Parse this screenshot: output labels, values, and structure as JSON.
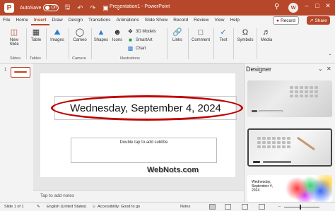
{
  "titlebar": {
    "autosave_label": "AutoSave",
    "autosave_state": "Off",
    "title": "Presentation1 - PowerPoint",
    "avatar_initials": "W"
  },
  "tabs": [
    "File",
    "Home",
    "Insert",
    "Draw",
    "Design",
    "Transitions",
    "Animations",
    "Slide Show",
    "Record",
    "Review",
    "View",
    "Help"
  ],
  "active_tab": "Insert",
  "tabbar": {
    "record_label": "Record",
    "share_label": "Share"
  },
  "ribbon": {
    "new_slide": "New\nSlide",
    "table": "Table",
    "images": "Images",
    "cameo": "Cameo",
    "shapes": "Shapes",
    "icons": "Icons",
    "models3d": "3D Models",
    "smartart": "SmartArt",
    "chart": "Chart",
    "links": "Links",
    "comment": "Comment",
    "text": "Text",
    "symbols": "Symbols",
    "media": "Media",
    "groups": {
      "slides": "Slides",
      "tables": "Tables",
      "camera": "Camera",
      "illustrations": "Illustrations"
    }
  },
  "thumbnails": {
    "slide_number": "1"
  },
  "slide": {
    "title": "Wednesday, September 4, 2024",
    "subtitle_placeholder": "Double tap to add subtitle",
    "watermark": "WebNots.com"
  },
  "notes": {
    "placeholder": "Tap to add notes"
  },
  "designer": {
    "title": "Designer",
    "design3_text": "Wednesday,\nSeptember 4,\n2024"
  },
  "statusbar": {
    "slide_info": "Slide 1 of 1",
    "language": "English (United States)",
    "accessibility": "Accessibility: Good to go",
    "notes": "Notes",
    "zoom": "–"
  },
  "colors": {
    "accent": "#b7472a",
    "highlight_oval": "#c00000"
  }
}
